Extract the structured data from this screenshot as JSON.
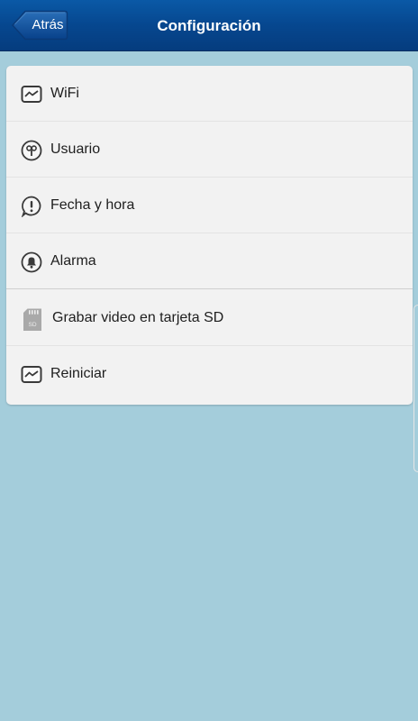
{
  "navbar": {
    "back_label": "Atrás",
    "title": "Configuración"
  },
  "menu": [
    {
      "label": "WiFi",
      "icon": "wifi-icon"
    },
    {
      "label": "Usuario",
      "icon": "user-icon"
    },
    {
      "label": "Fecha y hora",
      "icon": "clock-icon"
    },
    {
      "label": "Alarma",
      "icon": "bell-icon"
    },
    {
      "label": "Grabar video en tarjeta SD",
      "icon": "sd-card-icon",
      "icon_text": "SD"
    },
    {
      "label": "Reiniciar",
      "icon": "restart-icon"
    }
  ],
  "colors": {
    "background": "#a4cddb",
    "navbar": "#06478f",
    "card": "#f2f2f2"
  }
}
